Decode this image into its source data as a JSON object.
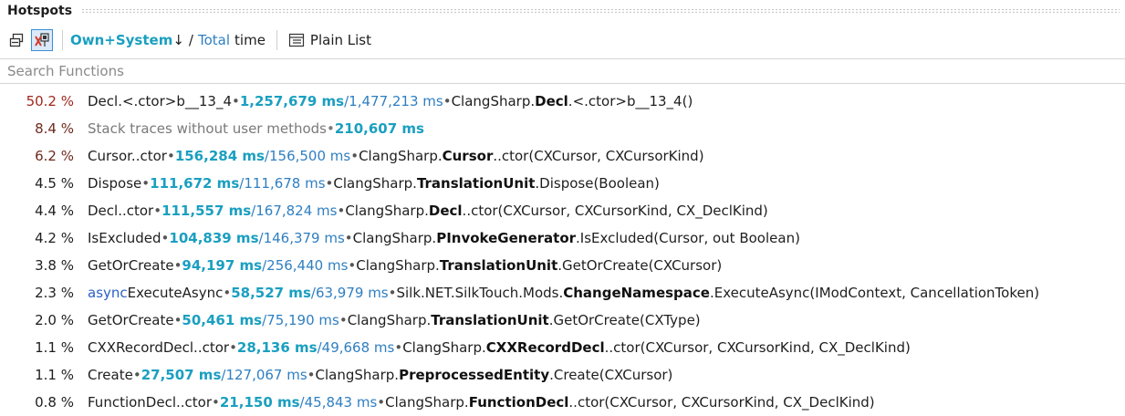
{
  "panel": {
    "title": "Hotspots"
  },
  "toolbar": {
    "own_system": "Own+System",
    "sort_arrow": "↓",
    "slash": "/",
    "total": "Total",
    "time": "time",
    "plain_list": "Plain List"
  },
  "search": {
    "placeholder": "Search Functions"
  },
  "rows": [
    {
      "pct": "50.2 %",
      "method": "Decl.<.ctor>b__13_4",
      "own": "1,257,679 ms",
      "total": "1,477,213 ms",
      "ns": "ClangSharp.",
      "cls": "Decl",
      "sig": ".<.ctor>b__13_4()"
    },
    {
      "pct": "8.4 %",
      "label": "Stack traces without user methods",
      "own": "210,607 ms"
    },
    {
      "pct": "6.2 %",
      "method": "Cursor..ctor",
      "own": "156,284 ms",
      "total": "156,500 ms",
      "ns": "ClangSharp.",
      "cls": "Cursor",
      "sig": "..ctor(CXCursor, CXCursorKind)"
    },
    {
      "pct": "4.5 %",
      "method": "Dispose",
      "own": "111,672 ms",
      "total": "111,678 ms",
      "ns": "ClangSharp.",
      "cls": "TranslationUnit",
      "sig": ".Dispose(Boolean)"
    },
    {
      "pct": "4.4 %",
      "method": "Decl..ctor",
      "own": "111,557 ms",
      "total": "167,824 ms",
      "ns": "ClangSharp.",
      "cls": "Decl",
      "sig": "..ctor(CXCursor, CXCursorKind, CX_DeclKind)"
    },
    {
      "pct": "4.2 %",
      "method": "IsExcluded",
      "own": "104,839 ms",
      "total": "146,379 ms",
      "ns": "ClangSharp.",
      "cls": "PInvokeGenerator",
      "sig": ".IsExcluded(Cursor, out Boolean)"
    },
    {
      "pct": "3.8 %",
      "method": "GetOrCreate",
      "own": "94,197 ms",
      "total": "256,440 ms",
      "ns": "ClangSharp.",
      "cls": "TranslationUnit",
      "sig": ".GetOrCreate(CXCursor)"
    },
    {
      "pct": "2.3 %",
      "keyword": "async",
      "method": "ExecuteAsync",
      "own": "58,527 ms",
      "total": "63,979 ms",
      "ns": "Silk.NET.SilkTouch.Mods.",
      "cls": "ChangeNamespace",
      "sig": ".ExecuteAsync(IModContext, CancellationToken)"
    },
    {
      "pct": "2.0 %",
      "method": "GetOrCreate",
      "own": "50,461 ms",
      "total": "75,190 ms",
      "ns": "ClangSharp.",
      "cls": "TranslationUnit",
      "sig": ".GetOrCreate(CXType)"
    },
    {
      "pct": "1.1 %",
      "method": "CXXRecordDecl..ctor",
      "own": "28,136 ms",
      "total": "49,668 ms",
      "ns": "ClangSharp.",
      "cls": "CXXRecordDecl",
      "sig": "..ctor(CXCursor, CXCursorKind, CX_DeclKind)"
    },
    {
      "pct": "1.1 %",
      "method": "Create",
      "own": "27,507 ms",
      "total": "127,067 ms",
      "ns": "ClangSharp.",
      "cls": "PreprocessedEntity",
      "sig": ".Create(CXCursor)"
    },
    {
      "pct": "0.8 %",
      "method": "FunctionDecl..ctor",
      "own": "21,150 ms",
      "total": "45,843 ms",
      "ns": "ClangSharp.",
      "cls": "FunctionDecl",
      "sig": "..ctor(CXCursor, CXCursorKind, CX_DeclKind)"
    }
  ],
  "colors": {
    "own_ms": "#1a9fc0",
    "total_ms": "#2f7fc1",
    "hot_pct": "#a0281e",
    "active_toggle": "#3a8fd8"
  },
  "icons": {
    "toggle_1": "switch-view-icon",
    "toggle_2": "filter-system-icon",
    "plain_list": "plain-list-icon"
  }
}
